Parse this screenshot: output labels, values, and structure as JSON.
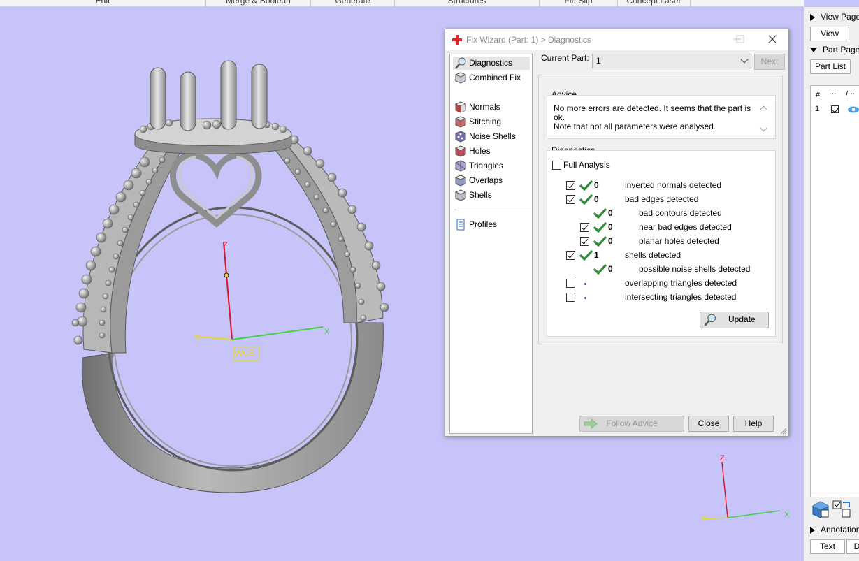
{
  "topbar": {
    "items": [
      "Edit",
      "Merge & Boolean",
      "Generate",
      "Structures",
      "FitLSlip",
      "Concept Laser"
    ]
  },
  "viewport": {
    "wcs_label": "WCS",
    "axis_z": "Z",
    "axis_x": "X",
    "axis_y": "Y",
    "colors": {
      "background": "#c6c4f8",
      "z_axis": "#e0102a",
      "x_axis": "#3fd13f",
      "y_axis": "#e8d62a"
    }
  },
  "right_panel": {
    "view_pages_label": "View Pages",
    "view_tab": "View",
    "part_pages_label": "Part Pages",
    "part_list_tab": "Part List",
    "col_hash": "#",
    "col_2": "‧‧‧",
    "col_3": "/‧‧‧",
    "row_num": "1",
    "annotations_label": "Annotations",
    "text_tab": "Text",
    "d_tab": "D"
  },
  "dialog": {
    "title": "Fix Wizard (Part: 1) > Diagnostics",
    "nav": [
      {
        "label": "Diagnostics",
        "icon": "magnifier-icon",
        "selected": true
      },
      {
        "label": "Combined Fix",
        "icon": "combined-fix-cube-icon"
      },
      {
        "label": "Normals",
        "icon": "normals-cube-icon"
      },
      {
        "label": "Stitching",
        "icon": "stitching-cube-icon"
      },
      {
        "label": "Noise Shells",
        "icon": "noise-shells-cube-icon"
      },
      {
        "label": "Holes",
        "icon": "holes-cube-icon"
      },
      {
        "label": "Triangles",
        "icon": "triangles-cube-icon"
      },
      {
        "label": "Overlaps",
        "icon": "overlaps-cube-icon"
      },
      {
        "label": "Shells",
        "icon": "shells-cube-icon"
      },
      {
        "label": "Profiles",
        "icon": "profiles-document-icon"
      }
    ],
    "current_part_label": "Current Part:",
    "current_part_value": "1",
    "next_button": "Next",
    "advice_title": "Advice",
    "advice_text": "No more errors are detected. It seems that the part is ok.\nNote that not all parameters were analysed.",
    "diagnostics_title": "Diagnostics",
    "full_analysis_label": "Full Analysis",
    "diagnostics": [
      {
        "checkbox": "checked",
        "status": "ok",
        "count": "0",
        "label": "inverted normals detected",
        "indent": 0
      },
      {
        "checkbox": "checked",
        "status": "ok",
        "count": "0",
        "label": "bad edges detected",
        "indent": 0
      },
      {
        "checkbox": "none",
        "status": "ok",
        "count": "0",
        "label": "bad contours detected",
        "indent": 1
      },
      {
        "checkbox": "checked",
        "status": "ok",
        "count": "0",
        "label": "near bad edges detected",
        "indent": 1
      },
      {
        "checkbox": "checked",
        "status": "ok",
        "count": "0",
        "label": "planar holes detected",
        "indent": 1
      },
      {
        "checkbox": "checked",
        "status": "ok",
        "count": "1",
        "label": "shells detected",
        "indent": 0
      },
      {
        "checkbox": "none",
        "status": "ok",
        "count": "0",
        "label": "possible noise shells detected",
        "indent": 1
      },
      {
        "checkbox": "unchecked",
        "status": "not-run",
        "count": "",
        "label": "overlapping triangles detected",
        "indent": 0
      },
      {
        "checkbox": "unchecked",
        "status": "not-run",
        "count": "",
        "label": "intersecting triangles detected",
        "indent": 0
      }
    ],
    "update_button": "Update",
    "follow_advice_button": "Follow Advice",
    "close_button": "Close",
    "help_button": "Help",
    "colors": {
      "check_green": "#2e8b3a"
    }
  }
}
